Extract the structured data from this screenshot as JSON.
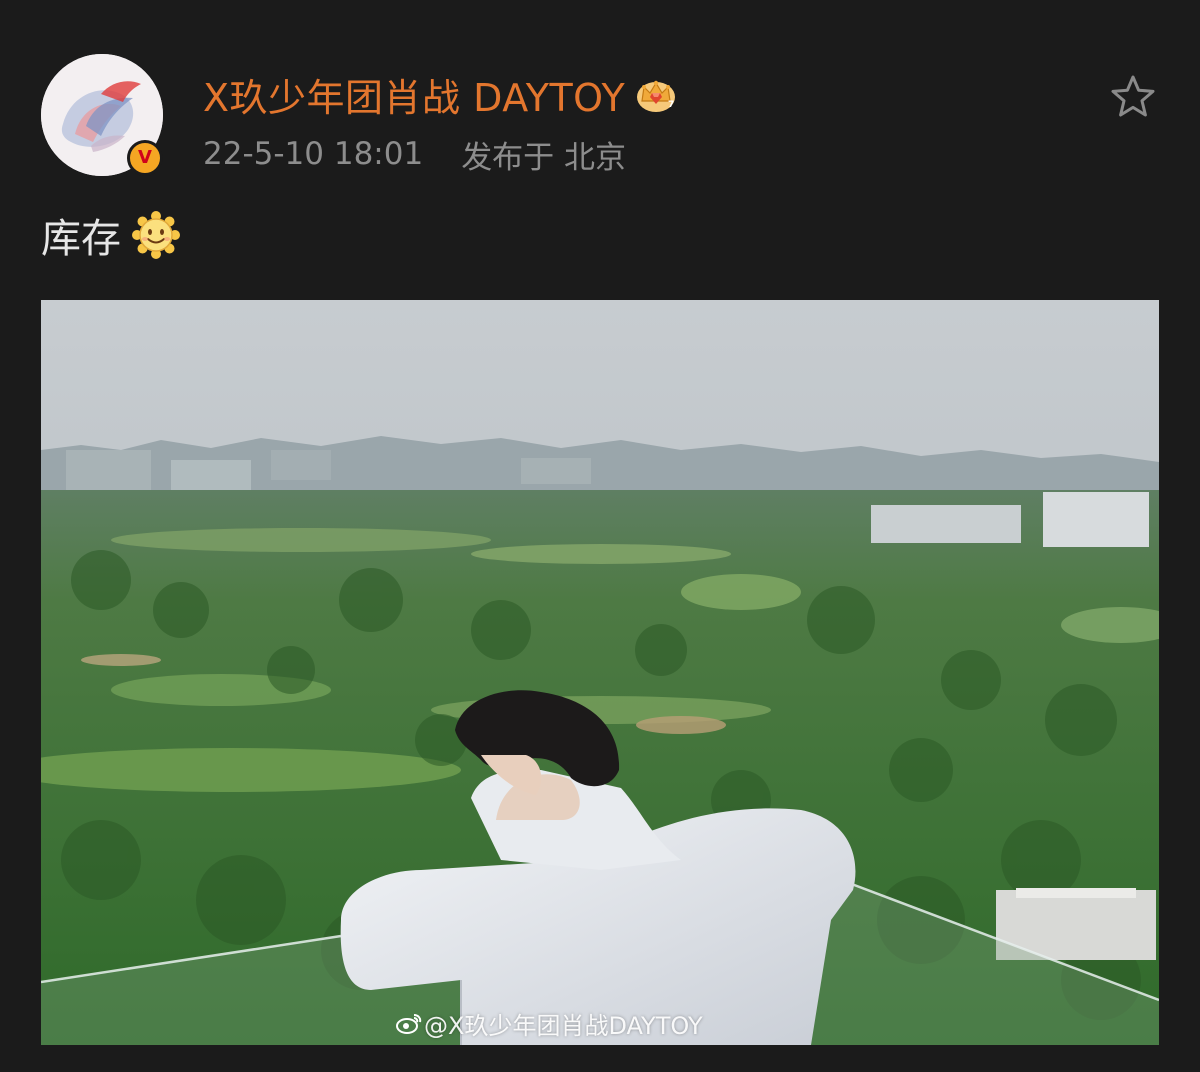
{
  "post": {
    "author": {
      "name": "X玖少年团肖战 DAYTOY",
      "verified_badge": "V",
      "avatar_icon": "avatar-image",
      "crown_icon": "crown-member-icon"
    },
    "meta": {
      "timestamp": "22-5-10 18:01",
      "location": "发布于 北京"
    },
    "actions": {
      "favorite_icon": "star-outline-icon"
    },
    "content": {
      "text": "库存",
      "emoji": "sun-smile-emoji"
    },
    "image": {
      "description_icon": "photo-icon",
      "watermark": "@X玖少年团肖战DAYTOY",
      "watermark_icon": "weibo-logo-icon"
    }
  },
  "colors": {
    "background": "#1b1b1b",
    "username": "#e3762e",
    "meta": "#8d8d8d",
    "text": "#e6e6e6"
  }
}
